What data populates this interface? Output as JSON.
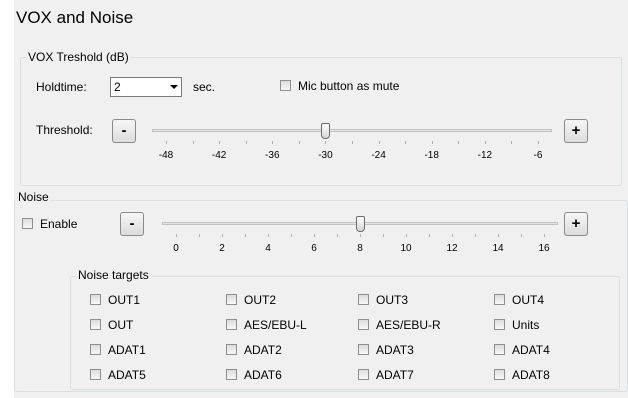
{
  "title": "VOX and Noise",
  "vox": {
    "group_label": "VOX Treshold (dB)",
    "holdtime_label": "Holdtime:",
    "holdtime_value": "2",
    "sec_label": "sec.",
    "mic_mute_label": "Mic button as mute",
    "mic_mute_checked": false,
    "threshold_label": "Threshold:",
    "minus_label": "-",
    "plus_label": "+",
    "slider": {
      "min": -48,
      "max": -6,
      "value": -30,
      "tick_labels": [
        "-48",
        "-42",
        "-36",
        "-30",
        "-24",
        "-18",
        "-12",
        "-6"
      ]
    }
  },
  "noise": {
    "group_label": "Noise",
    "enable_label": "Enable",
    "enable_checked": false,
    "minus_label": "-",
    "plus_label": "+",
    "slider": {
      "min": 0,
      "max": 16,
      "value": 8,
      "tick_labels": [
        "0",
        "2",
        "4",
        "6",
        "8",
        "10",
        "12",
        "14",
        "16"
      ]
    },
    "targets_label": "Noise targets",
    "targets": [
      [
        "OUT1",
        "OUT2",
        "OUT3",
        "OUT4"
      ],
      [
        "OUT",
        "AES/EBU-L",
        "AES/EBU-R",
        "Units"
      ],
      [
        "ADAT1",
        "ADAT2",
        "ADAT3",
        "ADAT4"
      ],
      [
        "ADAT5",
        "ADAT6",
        "ADAT7",
        "ADAT8"
      ]
    ]
  }
}
